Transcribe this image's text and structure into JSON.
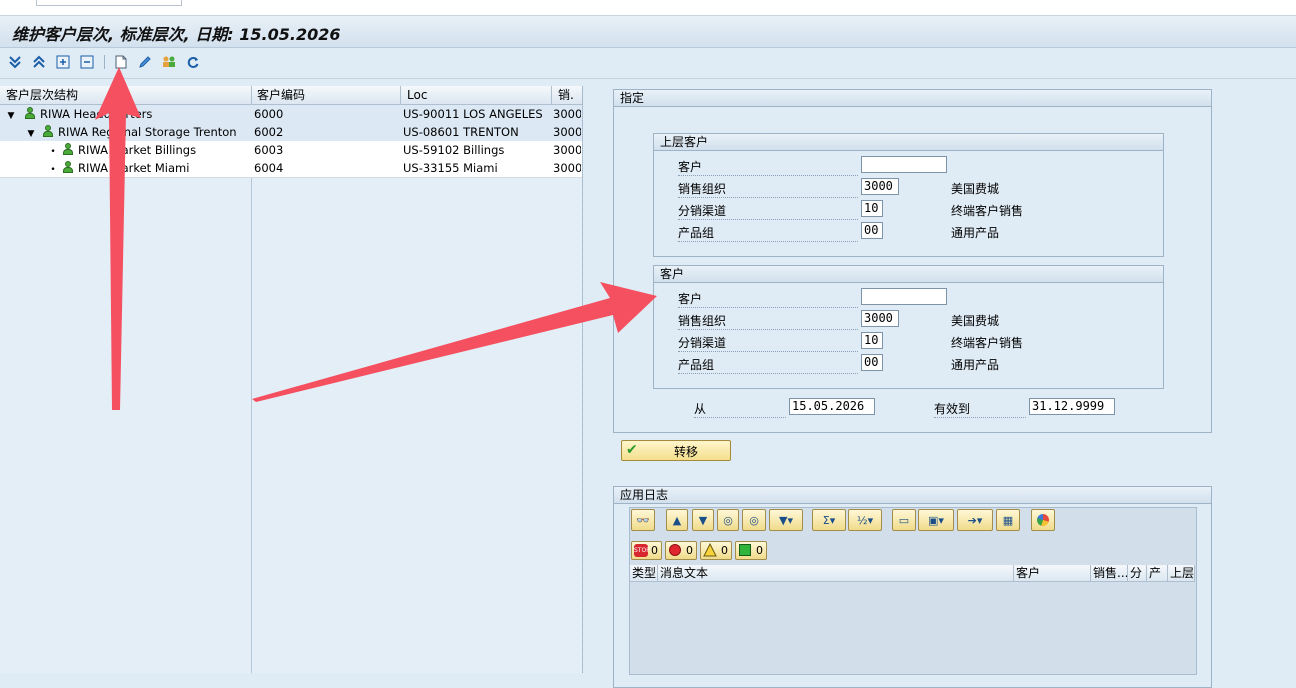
{
  "title": "维护客户层次, 标准层次, 日期: 15.05.2026",
  "toolbar": {
    "icons": [
      "expand-all-icon",
      "collapse-all-icon",
      "expand-node-icon",
      "collapse-node-icon",
      "create-icon",
      "edit-icon",
      "reassign-icon",
      "refresh-icon"
    ]
  },
  "tree": {
    "headers": {
      "structure": "客户层次结构",
      "customer_no": "客户编码",
      "loc": "Loc",
      "sales": "销."
    },
    "rows": [
      {
        "name": "RIWA Headquarters",
        "customer_no": "6000",
        "loc": "US-90011 LOS ANGELES",
        "sales": "3000"
      },
      {
        "name": "RIWA Regional Storage Trenton",
        "customer_no": "6002",
        "loc": "US-08601 TRENTON",
        "sales": "3000"
      },
      {
        "name": "RIWA Market Billings",
        "customer_no": "6003",
        "loc": "US-59102 Billings",
        "sales": "3000"
      },
      {
        "name": "RIWA Market Miami",
        "customer_no": "6004",
        "loc": "US-33155 Miami",
        "sales": "3000"
      }
    ]
  },
  "assign": {
    "title": "指定",
    "higher": {
      "title": "上层客户",
      "customer_label": "客户",
      "customer_value": "",
      "salesorg_label": "销售组织",
      "salesorg_value": "3000",
      "salesorg_desc": "美国费城",
      "channel_label": "分销渠道",
      "channel_value": "10",
      "channel_desc": "终端客户销售",
      "division_label": "产品组",
      "division_value": "00",
      "division_desc": "通用产品"
    },
    "customer": {
      "title": "客户",
      "customer_label": "客户",
      "customer_value": "",
      "salesorg_label": "销售组织",
      "salesorg_value": "3000",
      "salesorg_desc": "美国费城",
      "channel_label": "分销渠道",
      "channel_value": "10",
      "channel_desc": "终端客户销售",
      "division_label": "产品组",
      "division_value": "00",
      "division_desc": "通用产品"
    },
    "from_label": "从",
    "from_value": "15.05.2026",
    "to_label": "有效到",
    "to_value": "31.12.9999"
  },
  "transfer_button": "转移",
  "log": {
    "title": "应用日志",
    "counts": {
      "stop": "0",
      "error": "0",
      "warning": "0",
      "success": "0"
    },
    "headers": {
      "type": "类型",
      "message": "消息文本",
      "customer": "客户",
      "salesorg": "销售...",
      "div": "分",
      "prod": "产",
      "upper": "上层"
    }
  },
  "colors": {
    "background": "#dfebf5",
    "annotation_arrow": "#f5505f",
    "button": "#f4df8c"
  }
}
